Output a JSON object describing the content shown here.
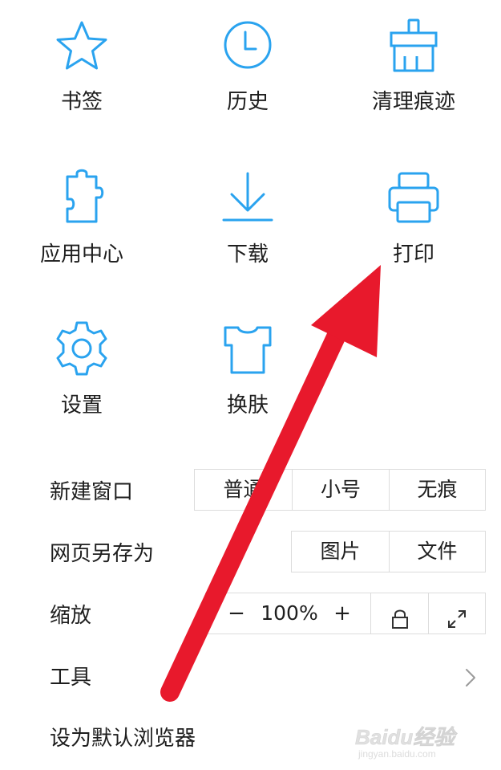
{
  "grid": {
    "bookmarks": {
      "label": "书签",
      "icon": "star-icon"
    },
    "history": {
      "label": "历史",
      "icon": "clock-icon"
    },
    "clear_traces": {
      "label": "清理痕迹",
      "icon": "broom-icon"
    },
    "app_center": {
      "label": "应用中心",
      "icon": "puzzle-icon"
    },
    "download": {
      "label": "下载",
      "icon": "download-icon"
    },
    "print": {
      "label": "打印",
      "icon": "printer-icon"
    },
    "settings": {
      "label": "设置",
      "icon": "gear-icon"
    },
    "skin": {
      "label": "换肤",
      "icon": "tshirt-icon"
    }
  },
  "menu": {
    "new_window": {
      "label": "新建窗口",
      "options": [
        "普通",
        "小号",
        "无痕"
      ]
    },
    "save_page_as": {
      "label": "网页另存为",
      "options": [
        "图片",
        "文件"
      ]
    },
    "zoom": {
      "label": "缩放",
      "minus": "−",
      "value": "100%",
      "plus": "+",
      "lock_icon": "lock-icon",
      "fullscreen_icon": "expand-icon"
    },
    "tools": {
      "label": "工具",
      "chevron_icon": "chevron-right-icon"
    },
    "set_default": {
      "label": "设为默认浏览器"
    }
  },
  "watermark": {
    "brand": "Baidu经验",
    "url": "jingyan.baidu.com"
  },
  "colors": {
    "icon_blue": "#2aa3ef",
    "arrow_red": "#e8192c",
    "border": "#dcdcdc",
    "text": "#1e1e1e"
  }
}
